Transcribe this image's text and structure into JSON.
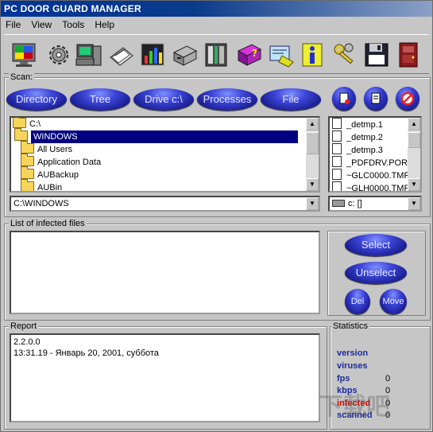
{
  "window": {
    "title": "PC DOOR GUARD MANAGER"
  },
  "menu": [
    {
      "name": "menu-file",
      "label": "File"
    },
    {
      "name": "menu-view",
      "label": "View"
    },
    {
      "name": "menu-tools",
      "label": "Tools"
    },
    {
      "name": "menu-help",
      "label": "Help"
    }
  ],
  "toolbar": {
    "icons": [
      "monitor-icon",
      "gear-icon",
      "computer-icon",
      "scanner-icon",
      "chart-icon",
      "drawer-icon",
      "server-icon",
      "help-book-icon",
      "certificate-icon",
      "info-icon",
      "keys-icon",
      "floppy-disk-icon",
      "exit-door-icon"
    ]
  },
  "scan": {
    "legend": "Scan:",
    "buttons": {
      "directory": "Directory",
      "tree": "Tree",
      "drive": "Drive c:\\",
      "processes": "Processes",
      "file": "File"
    },
    "dir_path_root": "C:\\",
    "tree_items": [
      {
        "label": "WINDOWS",
        "selected": true
      },
      {
        "label": "All Users",
        "selected": false
      },
      {
        "label": "Application Data",
        "selected": false
      },
      {
        "label": "AUBackup",
        "selected": false
      },
      {
        "label": "AUBin",
        "selected": false
      }
    ],
    "path_combo": "C:\\WINDOWS",
    "files": [
      "_detmp.1",
      "_detmp.2",
      "_detmp.3",
      "_PDFDRV.PORT",
      "~GLC0000.TMP",
      "~GLH0000.TMP"
    ],
    "drive_combo": "c: []"
  },
  "infected": {
    "legend": "List of infected files",
    "buttons": {
      "select": "Select",
      "unselect": "Unselect",
      "del": "Del",
      "move": "Move"
    }
  },
  "report": {
    "legend": "Report",
    "lines": [
      "2.2.0.0",
      "13:31.19 - Январь 20, 2001, суббота"
    ]
  },
  "statistics": {
    "legend": "Statistics",
    "items": [
      {
        "label": "version",
        "value": "",
        "color": "#1b2c9a"
      },
      {
        "label": "viruses",
        "value": "",
        "color": "#1b2c9a"
      },
      {
        "label": "fps",
        "value": "0",
        "color": "#1b2c9a"
      },
      {
        "label": "kbps",
        "value": "0",
        "color": "#1b2c9a"
      },
      {
        "label": "infected",
        "value": "0",
        "color": "#e00000"
      },
      {
        "label": "scanned",
        "value": "0",
        "color": "#1b2c9a"
      }
    ]
  },
  "watermark": "下载吧"
}
